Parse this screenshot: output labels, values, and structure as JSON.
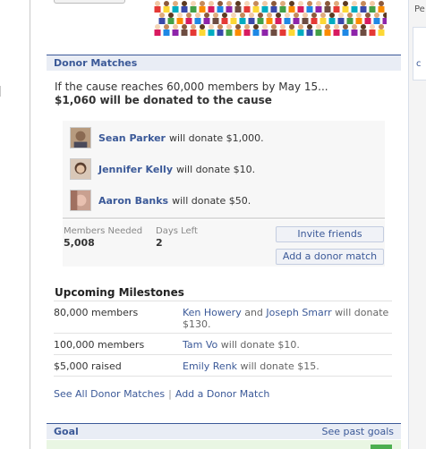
{
  "right_panel": {
    "label": "Pe",
    "letter": "c"
  },
  "donor_matches": {
    "header": "Donor Matches",
    "intro_line1": "If the cause reaches 60,000 members by May 15...",
    "intro_line2": "$1,060 will be donated to the cause",
    "donors": [
      {
        "name": "Sean Parker",
        "amount": "will donate $1,000."
      },
      {
        "name": "Jennifer Kelly",
        "amount": "will donate $10."
      },
      {
        "name": "Aaron Banks",
        "amount": "will donate $50."
      }
    ],
    "stats": {
      "members_needed_label": "Members Needed",
      "members_needed_value": "5,008",
      "days_left_label": "Days Left",
      "days_left_value": "2"
    },
    "buttons": {
      "invite": "Invite friends",
      "add_match": "Add a donor match"
    }
  },
  "milestones": {
    "title": "Upcoming Milestones",
    "rows": [
      {
        "target": "80,000 members",
        "donor1": "Ken Howery",
        "joiner": "and",
        "donor2": "Joseph Smarr",
        "text": "will donate $130."
      },
      {
        "target": "100,000 members",
        "donor1": "Tam Vo",
        "text": "will donate $10."
      },
      {
        "target": "$5,000 raised",
        "donor1": "Emily Renk",
        "text": "will donate $15."
      }
    ]
  },
  "footer_links": {
    "see_all": "See All Donor Matches",
    "separator": "|",
    "add": "Add a Donor Match"
  },
  "goal": {
    "header": "Goal",
    "link": "See past goals"
  },
  "colors": {
    "link": "#3b5998",
    "section_bg": "#e9edf5",
    "goal_bg": "#e9f6e3"
  }
}
